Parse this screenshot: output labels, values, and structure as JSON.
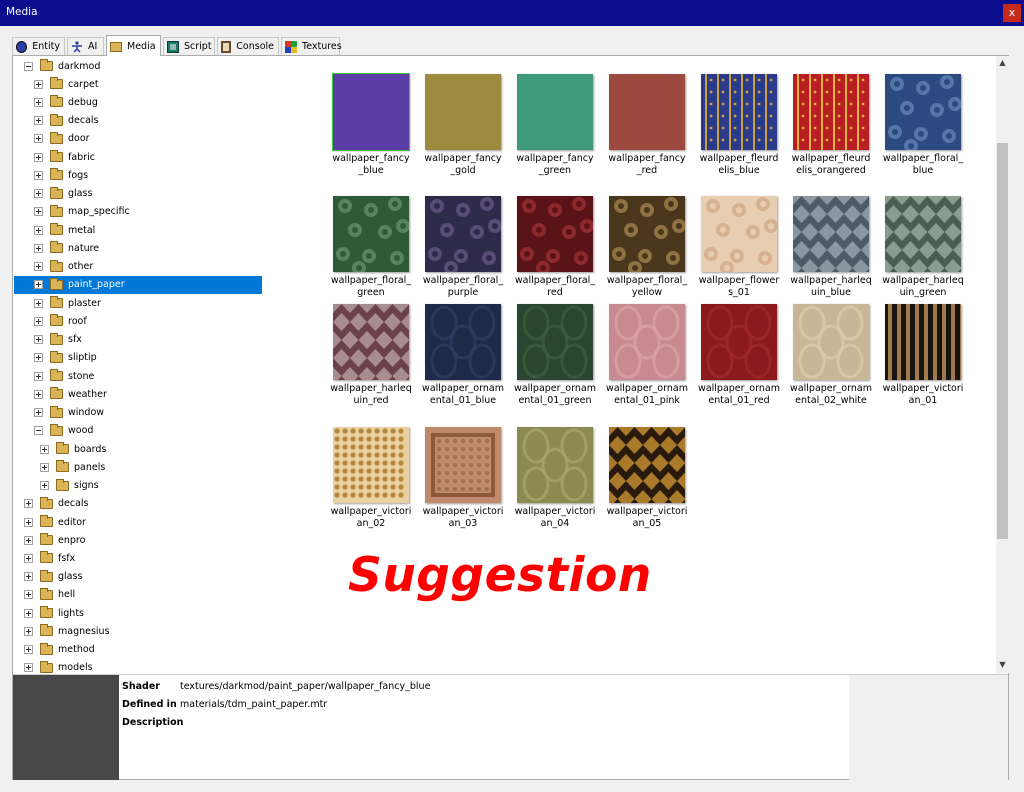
{
  "window": {
    "title": "Media",
    "close_glyph": "x"
  },
  "tabs": [
    {
      "label": "Entity",
      "icon": "entity-icon",
      "color": "#2a3aa8"
    },
    {
      "label": "AI",
      "icon": "ai-icon",
      "color": "#2a3aa8"
    },
    {
      "label": "Media",
      "icon": "folder-icon",
      "color": "#dcb458",
      "active": true
    },
    {
      "label": "Script",
      "icon": "script-icon",
      "color": "#1a7a6a"
    },
    {
      "label": "Console",
      "icon": "console-icon",
      "color": "#6a4a2a"
    },
    {
      "label": "Textures",
      "icon": "textures-icon",
      "color": "#d04020"
    }
  ],
  "tree": [
    {
      "label": "darkmod",
      "depth": 0,
      "state": "expanded"
    },
    {
      "label": "carpet",
      "depth": 1,
      "state": "collapsed"
    },
    {
      "label": "debug",
      "depth": 1,
      "state": "collapsed"
    },
    {
      "label": "decals",
      "depth": 1,
      "state": "collapsed"
    },
    {
      "label": "door",
      "depth": 1,
      "state": "collapsed"
    },
    {
      "label": "fabric",
      "depth": 1,
      "state": "collapsed"
    },
    {
      "label": "fogs",
      "depth": 1,
      "state": "collapsed"
    },
    {
      "label": "glass",
      "depth": 1,
      "state": "collapsed"
    },
    {
      "label": "map_specific",
      "depth": 1,
      "state": "collapsed"
    },
    {
      "label": "metal",
      "depth": 1,
      "state": "collapsed"
    },
    {
      "label": "nature",
      "depth": 1,
      "state": "collapsed"
    },
    {
      "label": "other",
      "depth": 1,
      "state": "collapsed"
    },
    {
      "label": "paint_paper",
      "depth": 1,
      "state": "collapsed",
      "selected": true
    },
    {
      "label": "plaster",
      "depth": 1,
      "state": "collapsed"
    },
    {
      "label": "roof",
      "depth": 1,
      "state": "collapsed"
    },
    {
      "label": "sfx",
      "depth": 1,
      "state": "collapsed"
    },
    {
      "label": "sliptip",
      "depth": 1,
      "state": "collapsed"
    },
    {
      "label": "stone",
      "depth": 1,
      "state": "collapsed"
    },
    {
      "label": "weather",
      "depth": 1,
      "state": "collapsed"
    },
    {
      "label": "window",
      "depth": 1,
      "state": "collapsed"
    },
    {
      "label": "wood",
      "depth": 1,
      "state": "expanded"
    },
    {
      "label": "boards",
      "depth": 2,
      "state": "collapsed"
    },
    {
      "label": "panels",
      "depth": 2,
      "state": "collapsed"
    },
    {
      "label": "signs",
      "depth": 2,
      "state": "collapsed"
    },
    {
      "label": "decals",
      "depth": 0,
      "state": "collapsed"
    },
    {
      "label": "editor",
      "depth": 0,
      "state": "collapsed"
    },
    {
      "label": "enpro",
      "depth": 0,
      "state": "collapsed"
    },
    {
      "label": "fsfx",
      "depth": 0,
      "state": "collapsed"
    },
    {
      "label": "glass",
      "depth": 0,
      "state": "collapsed"
    },
    {
      "label": "hell",
      "depth": 0,
      "state": "collapsed"
    },
    {
      "label": "lights",
      "depth": 0,
      "state": "collapsed"
    },
    {
      "label": "magnesius",
      "depth": 0,
      "state": "collapsed"
    },
    {
      "label": "method",
      "depth": 0,
      "state": "collapsed"
    },
    {
      "label": "models",
      "depth": 0,
      "state": "collapsed"
    }
  ],
  "textures": [
    {
      "label": "wallpaper_fancy_blue",
      "color": "#5a3ea6",
      "pattern": "solid",
      "selected": true
    },
    {
      "label": "wallpaper_fancy_gold",
      "color": "#9c8a3e",
      "pattern": "solid"
    },
    {
      "label": "wallpaper_fancy_green",
      "color": "#3e9a7a",
      "pattern": "solid"
    },
    {
      "label": "wallpaper_fancy_red",
      "color": "#9c4a3e",
      "pattern": "solid"
    },
    {
      "label": "wallpaper_fleurdelis_blue",
      "color": "#2c3a8a",
      "accent": "#c8a040",
      "pattern": "stripe-narrow"
    },
    {
      "label": "wallpaper_fleurdelis_orangered",
      "color": "#b81e22",
      "accent": "#e0b040",
      "pattern": "stripe-narrow"
    },
    {
      "label": "wallpaper_floral_blue",
      "color": "#2a4a80",
      "accent": "#7a9ac8",
      "pattern": "floral"
    },
    {
      "label": "wallpaper_floral_green",
      "color": "#2e5a36",
      "accent": "#7aa880",
      "pattern": "floral"
    },
    {
      "label": "wallpaper_floral_purple",
      "color": "#2e2a4a",
      "accent": "#7a6a9a",
      "pattern": "floral"
    },
    {
      "label": "wallpaper_floral_red",
      "color": "#5a1418",
      "accent": "#b83a40",
      "pattern": "floral"
    },
    {
      "label": "wallpaper_floral_yellow",
      "color": "#4a361c",
      "accent": "#c8a460",
      "pattern": "floral"
    },
    {
      "label": "wallpaper_flowers_01",
      "color": "#e8ceb0",
      "accent": "#c89a78",
      "pattern": "floral-light"
    },
    {
      "label": "wallpaper_harlequin_blue",
      "color": "#4e5a66",
      "accent": "#8a96a0",
      "pattern": "diamond"
    },
    {
      "label": "wallpaper_harlequin_green",
      "color": "#4a5e52",
      "accent": "#8a9e90",
      "pattern": "diamond"
    },
    {
      "label": "wallpaper_harlequin_red",
      "color": "#6a4248",
      "accent": "#a88c90",
      "pattern": "diamond"
    },
    {
      "label": "wallpaper_ornamental_01_blue",
      "color": "#1e2a48",
      "accent": "#2e3c60",
      "pattern": "damask"
    },
    {
      "label": "wallpaper_ornamental_01_green",
      "color": "#2a4630",
      "accent": "#3c5c42",
      "pattern": "damask"
    },
    {
      "label": "wallpaper_ornamental_01_pink",
      "color": "#c88a90",
      "accent": "#d8a0a6",
      "pattern": "damask"
    },
    {
      "label": "wallpaper_ornamental_01_red",
      "color": "#8a1a1e",
      "accent": "#a0282c",
      "pattern": "damask"
    },
    {
      "label": "wallpaper_ornamental_02_white",
      "color": "#c8b696",
      "accent": "#dccaa8",
      "pattern": "damask"
    },
    {
      "label": "wallpaper_victorian_01",
      "color": "#1a1410",
      "accent": "#a07a4a",
      "pattern": "stripe-wide"
    },
    {
      "label": "wallpaper_victorian_02",
      "color": "#e8d0a0",
      "accent": "#b8863a",
      "pattern": "dots"
    },
    {
      "label": "wallpaper_victorian_03",
      "color": "#c08a6a",
      "accent": "#8a5a3a",
      "pattern": "frame"
    },
    {
      "label": "wallpaper_victorian_04",
      "color": "#8c8a50",
      "accent": "#a8a46a",
      "pattern": "damask"
    },
    {
      "label": "wallpaper_victorian_05",
      "color": "#2a1a0e",
      "accent": "#a87a2a",
      "pattern": "diamond-dark"
    }
  ],
  "overlay": {
    "text": "Suggestion",
    "color": "#ff0000"
  },
  "info": {
    "shader_label": "Shader",
    "shader_value": "textures/darkmod/paint_paper/wallpaper_fancy_blue",
    "defined_label": "Defined in",
    "defined_value": "materials/tdm_paint_paper.mtr",
    "description_label": "Description",
    "description_value": ""
  }
}
